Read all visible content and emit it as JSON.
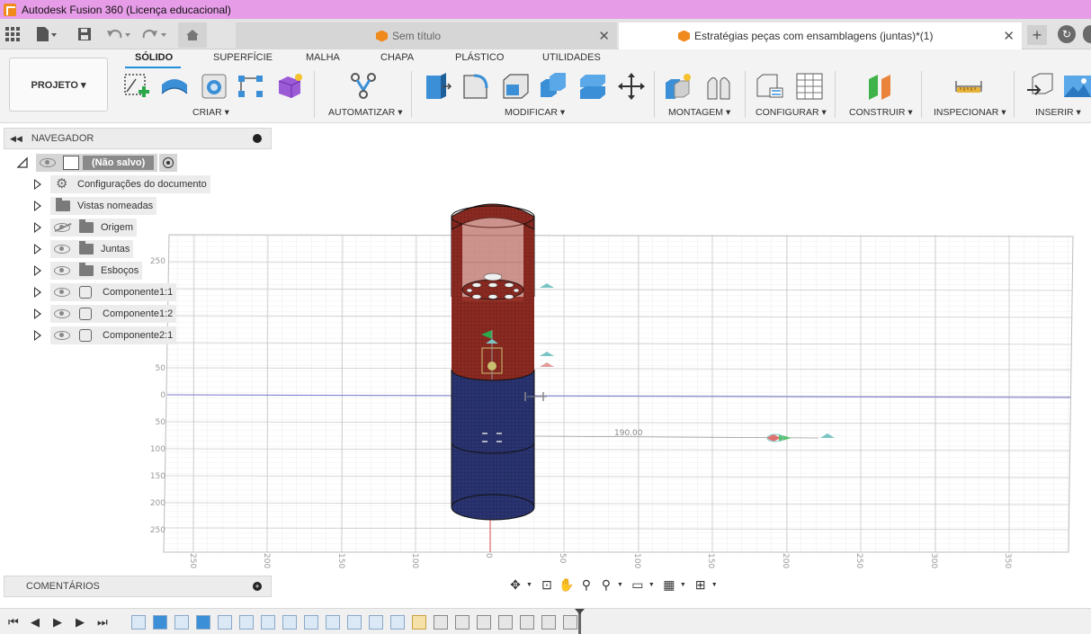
{
  "titlebar": {
    "title": "Autodesk Fusion 360 (Licença educacional)"
  },
  "tabs": {
    "inactive_label": "Sem título",
    "active_label": "Estratégias peças com ensamblagens (juntas)*(1)"
  },
  "ribbon": {
    "project_label": "PROJETO ▾",
    "tabs": [
      "SÓLIDO",
      "SUPERFÍCIE",
      "MALHA",
      "CHAPA",
      "PLÁSTICO",
      "UTILIDADES"
    ],
    "groups": {
      "criar": "CRIAR ▾",
      "automatizar": "AUTOMATIZAR ▾",
      "modificar": "MODIFICAR ▾",
      "montagem": "MONTAGEM ▾",
      "configurar": "CONFIGURAR ▾",
      "construir": "CONSTRUIR ▾",
      "inspecionar": "INSPECIONAR ▾",
      "inserir": "INSERIR ▾"
    }
  },
  "navigator": {
    "title": "NAVEGADOR",
    "root_label": "(Não salvo)",
    "items": [
      {
        "label": "Configurações do documento",
        "icon": "gear-icon"
      },
      {
        "label": "Vistas nomeadas",
        "icon": "folder-icon"
      },
      {
        "label": "Origem",
        "icon": "folder-icon",
        "visible": false
      },
      {
        "label": "Juntas",
        "icon": "folder-icon",
        "visible": true
      },
      {
        "label": "Esboços",
        "icon": "folder-icon",
        "visible": true
      },
      {
        "label": "Componente1:1",
        "icon": "component-icon",
        "visible": true
      },
      {
        "label": "Componente1:2",
        "icon": "component-icon",
        "visible": true
      },
      {
        "label": "Componente2:1",
        "icon": "component-icon",
        "visible": true
      }
    ]
  },
  "comments": {
    "title": "COMENTÁRIOS"
  },
  "viewport": {
    "dimension_label": "190.00",
    "grid_labels_y": [
      "250",
      "50",
      "0",
      "50",
      "100",
      "150",
      "200",
      "250"
    ],
    "grid_labels_x": [
      "250",
      "200",
      "150",
      "100",
      "50",
      "0",
      "50",
      "100",
      "150",
      "200",
      "250",
      "300",
      "350"
    ],
    "colors": {
      "red_component": "#8b2a22",
      "blue_component": "#2a3470",
      "grid": "#c9c9c9",
      "x_axis": "#7a7ad0",
      "y_axis": "#e05050"
    }
  }
}
